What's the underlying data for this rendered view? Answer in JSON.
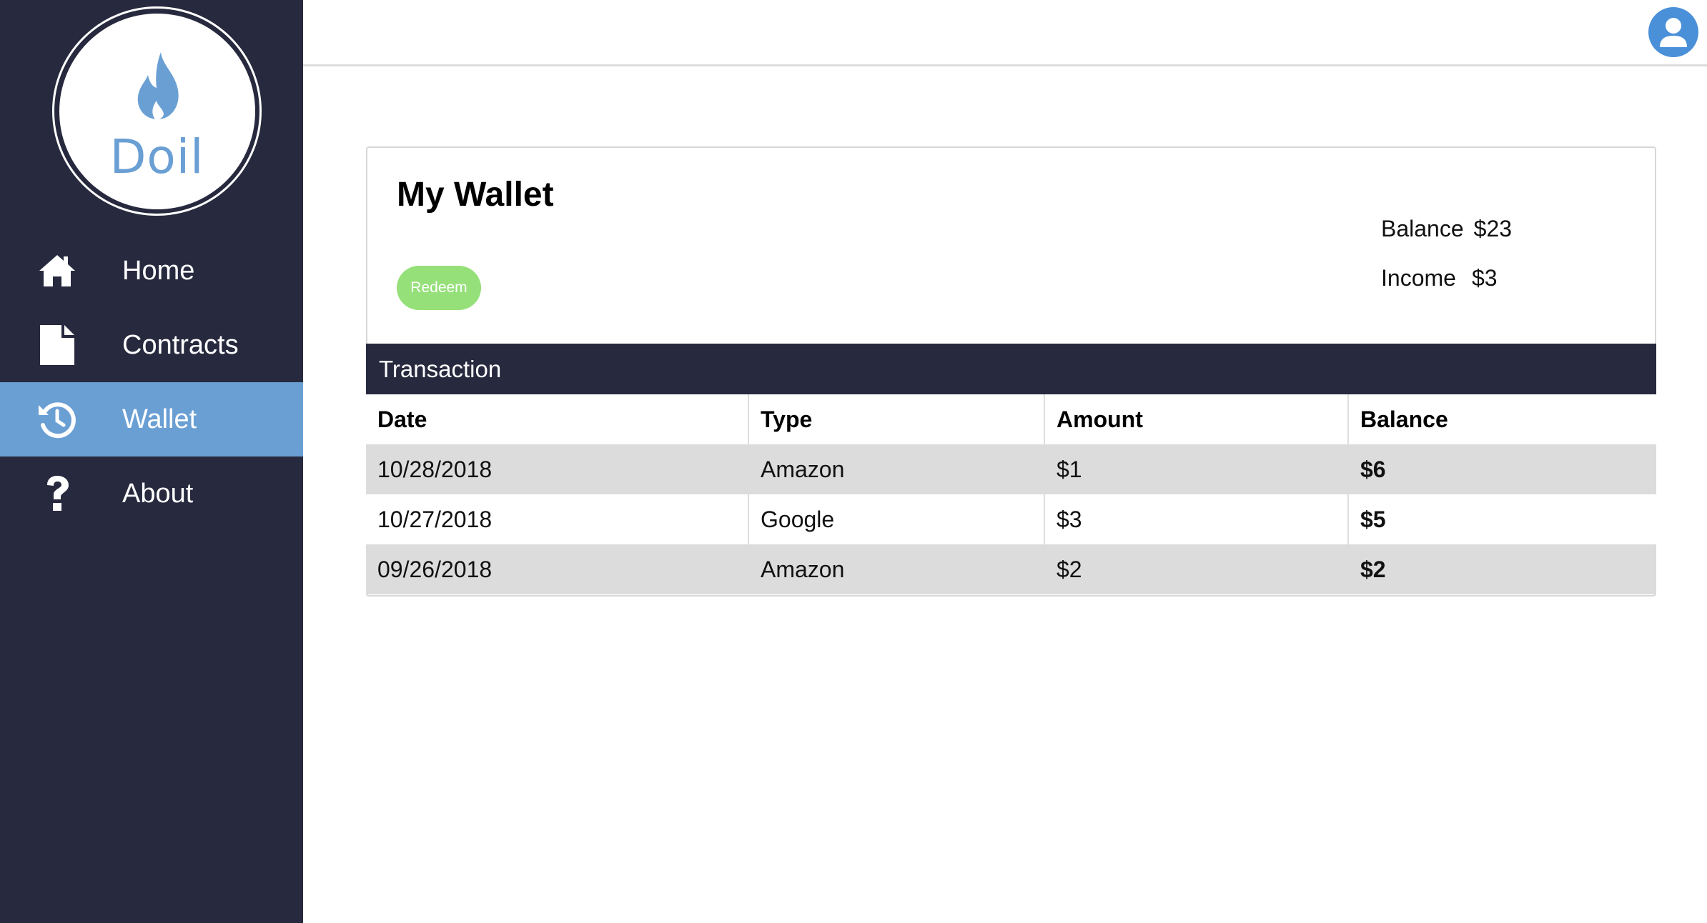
{
  "brand": {
    "name": "Doil",
    "accent": "#6a9fd4",
    "sidebar_bg": "#272a3e"
  },
  "nav": {
    "items": [
      {
        "label": "Home",
        "icon": "home-icon",
        "active": false
      },
      {
        "label": "Contracts",
        "icon": "document-icon",
        "active": false
      },
      {
        "label": "Wallet",
        "icon": "history-icon",
        "active": true
      },
      {
        "label": "About",
        "icon": "question-icon",
        "active": false
      }
    ]
  },
  "header": {
    "avatar_icon": "user-avatar-icon"
  },
  "wallet": {
    "title": "My Wallet",
    "redeem_label": "Redeem",
    "balance_label": "Balance",
    "balance_value": "$23",
    "income_label": "Income",
    "income_value": "$3"
  },
  "transactions": {
    "title": "Transaction",
    "columns": [
      "Date",
      "Type",
      "Amount",
      "Balance"
    ],
    "rows": [
      [
        "10/28/2018",
        "Amazon",
        "$1",
        "$6"
      ],
      [
        "10/27/2018",
        "Google",
        "$3",
        "$5"
      ],
      [
        "09/26/2018",
        "Amazon",
        "$2",
        "$2"
      ]
    ]
  }
}
